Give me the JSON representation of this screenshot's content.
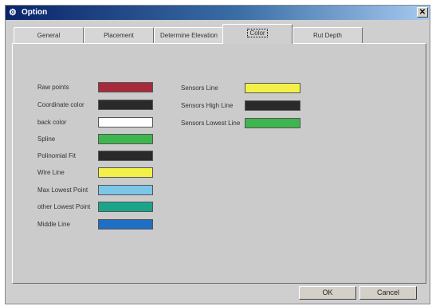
{
  "window": {
    "title": "Option"
  },
  "tabs": [
    {
      "label": "General",
      "active": false
    },
    {
      "label": "Placement",
      "active": false
    },
    {
      "label": "Determine Elevation",
      "active": false
    },
    {
      "label": "Color",
      "active": true
    },
    {
      "label": "Rut Depth",
      "active": false
    }
  ],
  "left_colors": [
    {
      "label": "Raw points",
      "color": "#a52a3c"
    },
    {
      "label": "Coordinate color",
      "color": "#2a2a2a"
    },
    {
      "label": "back color",
      "color": "#ffffff"
    },
    {
      "label": "Spline",
      "color": "#3fb54f"
    },
    {
      "label": "Polinomial Fit",
      "color": "#2a2a2a"
    },
    {
      "label": "Wire Line",
      "color": "#f4f04a"
    },
    {
      "label": "Max Lowest Point",
      "color": "#7cc6e8"
    },
    {
      "label": "other Lowest Point",
      "color": "#1aa58a"
    },
    {
      "label": "Middle Line",
      "color": "#1f6fc4"
    }
  ],
  "right_colors": [
    {
      "label": "Sensors Line",
      "color": "#f4f04a"
    },
    {
      "label": "Sensors High Line",
      "color": "#2a2a2a"
    },
    {
      "label": "Sensors Lowest Line",
      "color": "#3fb54f"
    }
  ],
  "buttons": {
    "ok": "OK",
    "cancel": "Cancel"
  }
}
